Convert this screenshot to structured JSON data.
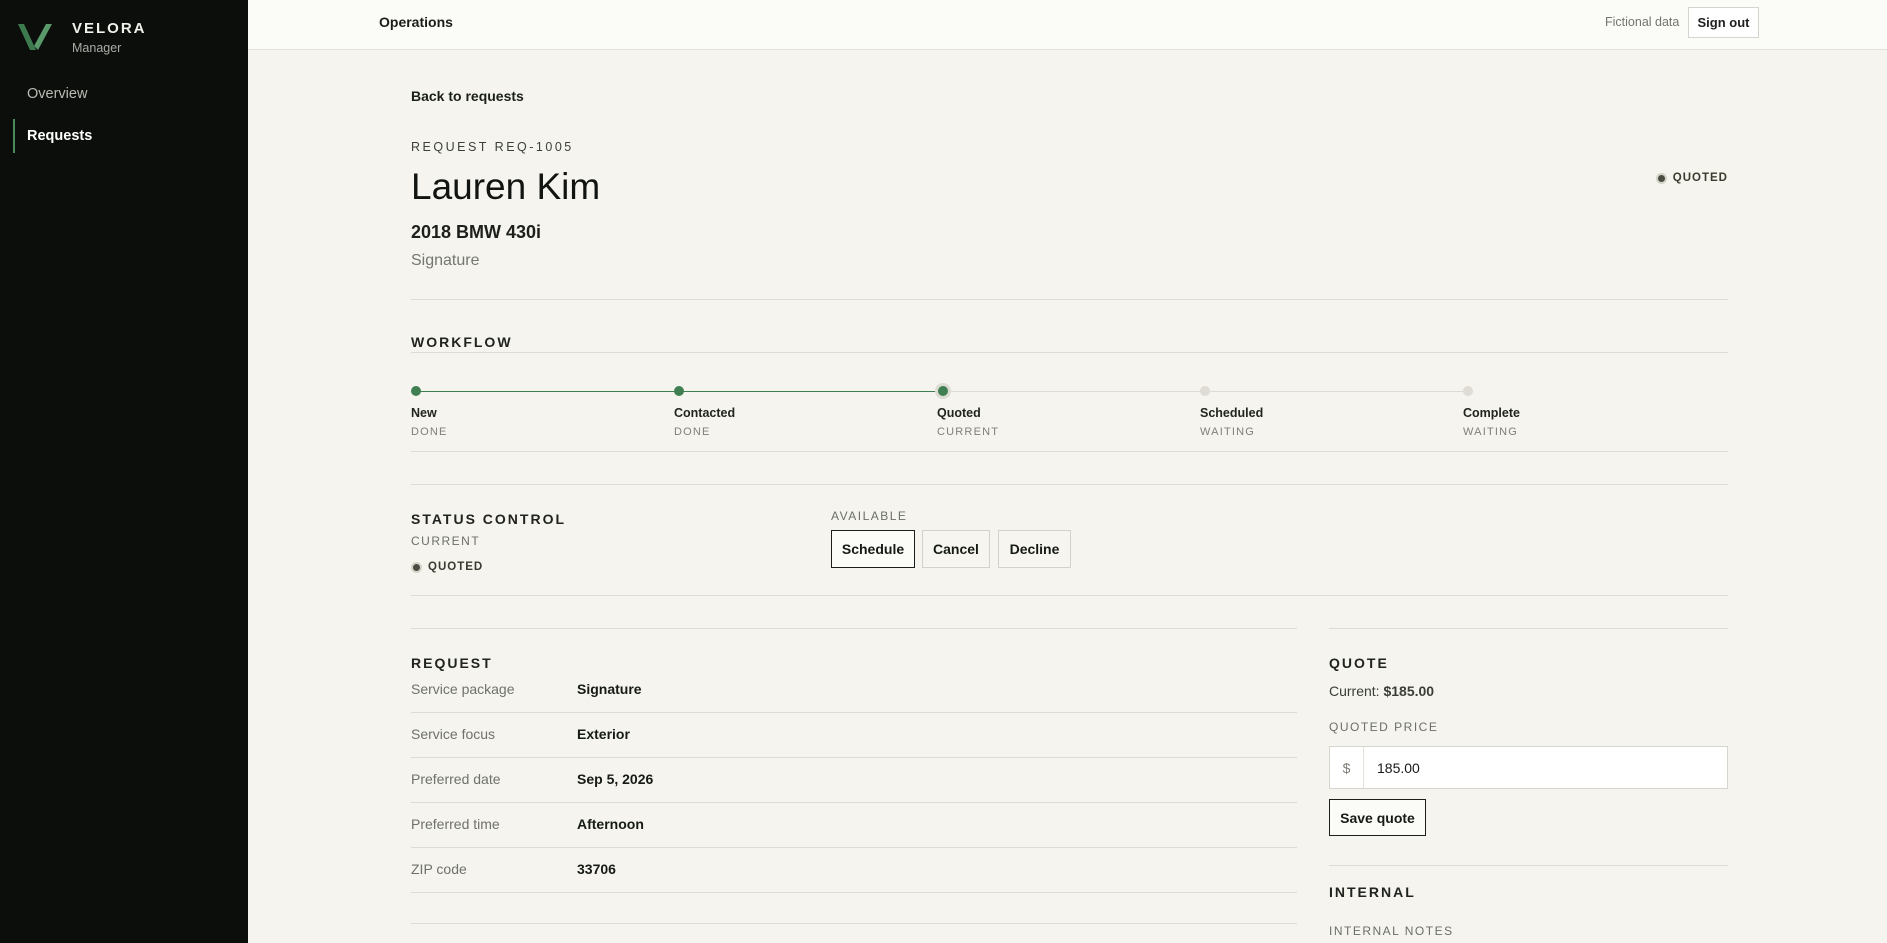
{
  "sidebar": {
    "brand_name": "VELORA",
    "brand_sub": "Manager",
    "items": [
      {
        "label": "Overview"
      },
      {
        "label": "Requests"
      }
    ]
  },
  "topbar": {
    "title": "Operations",
    "fictional_note": "Fictional data",
    "signout_label": "Sign out"
  },
  "header": {
    "back_label": "Back to requests",
    "request_id": "REQUEST REQ-1005",
    "customer_name": "Lauren Kim",
    "vehicle": "2018 BMW 430i",
    "package": "Signature",
    "status": "QUOTED"
  },
  "workflow": {
    "title": "WORKFLOW",
    "steps": [
      {
        "label": "New",
        "state": "DONE"
      },
      {
        "label": "Contacted",
        "state": "DONE"
      },
      {
        "label": "Quoted",
        "state": "CURRENT"
      },
      {
        "label": "Scheduled",
        "state": "WAITING"
      },
      {
        "label": "Complete",
        "state": "WAITING"
      }
    ]
  },
  "status_control": {
    "title": "STATUS CONTROL",
    "current_label": "CURRENT",
    "current_status": "QUOTED",
    "available_label": "AVAILABLE",
    "actions": [
      "Schedule",
      "Cancel",
      "Decline"
    ]
  },
  "request": {
    "title": "REQUEST",
    "rows": [
      {
        "key": "Service package",
        "value": "Signature"
      },
      {
        "key": "Service focus",
        "value": "Exterior"
      },
      {
        "key": "Preferred date",
        "value": "Sep 5, 2026"
      },
      {
        "key": "Preferred time",
        "value": "Afternoon"
      },
      {
        "key": "ZIP code",
        "value": "33706"
      }
    ]
  },
  "quote": {
    "title": "QUOTE",
    "current_prefix": "Current:",
    "current_value": "$185.00",
    "price_label": "QUOTED PRICE",
    "currency_symbol": "$",
    "price_value": "185.00",
    "save_label": "Save quote"
  },
  "internal": {
    "title": "INTERNAL",
    "notes_label": "INTERNAL NOTES"
  },
  "colors": {
    "sidebar_bg": "#0b0e0b",
    "accent_green": "#3f7f52",
    "page_bg": "#f5f4ef"
  }
}
